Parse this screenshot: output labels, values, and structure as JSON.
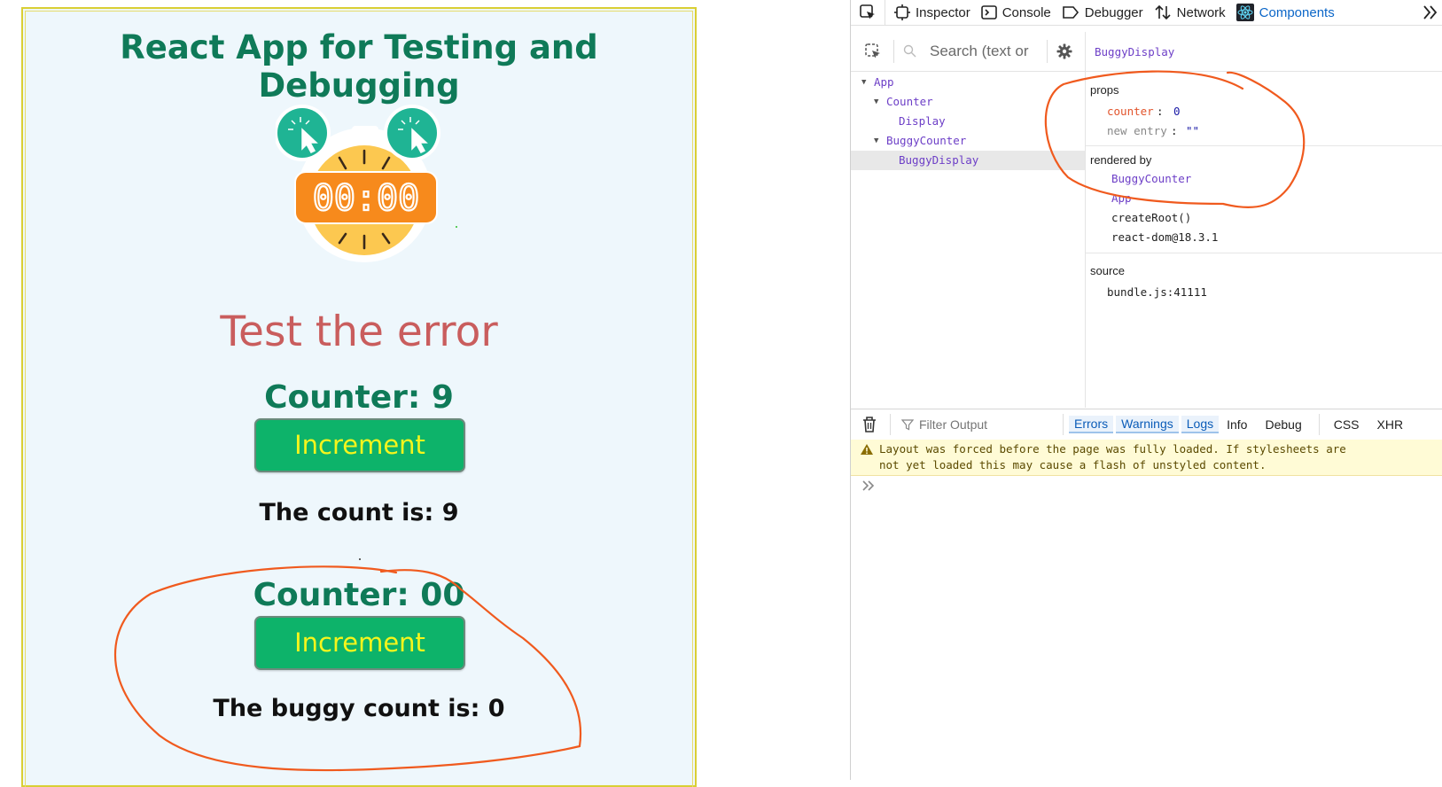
{
  "app": {
    "title": "React App for Testing and Debugging",
    "timer_display": "00:00",
    "section_heading": "Test the error",
    "counter_one": {
      "title": "Counter: 9",
      "button_label": "Increment",
      "count_text": "The count is: 9"
    },
    "counter_two": {
      "title": "Counter: 00",
      "button_label": "Increment",
      "count_text": "The buggy count is: 0"
    }
  },
  "devtools": {
    "tabs": [
      {
        "label": "Inspector",
        "icon": "inspector-icon"
      },
      {
        "label": "Console",
        "icon": "console-icon"
      },
      {
        "label": "Debugger",
        "icon": "debugger-icon"
      },
      {
        "label": "Network",
        "icon": "network-icon"
      },
      {
        "label": "Components",
        "icon": "react-icon",
        "active": true
      }
    ],
    "components": {
      "search_placeholder": "Search (text or",
      "selected_component": "BuggyDisplay",
      "tree": [
        {
          "label": "App",
          "depth": 0,
          "expanded": true
        },
        {
          "label": "Counter",
          "depth": 1,
          "expanded": true
        },
        {
          "label": "Display",
          "depth": 2
        },
        {
          "label": "BuggyCounter",
          "depth": 1,
          "expanded": true
        },
        {
          "label": "BuggyDisplay",
          "depth": 2,
          "selected": true
        }
      ],
      "props_label": "props",
      "props": [
        {
          "key": "counter",
          "value": "0"
        },
        {
          "key": "new entry",
          "value": "\"\""
        }
      ],
      "rendered_by_label": "rendered by",
      "rendered_by": [
        "BuggyCounter",
        "App",
        "createRoot()",
        "react-dom@18.3.1"
      ],
      "source_label": "source",
      "source": "bundle.js:41111"
    },
    "console": {
      "filter_placeholder": "Filter Output",
      "filters": [
        "Errors",
        "Warnings",
        "Logs",
        "Info",
        "Debug",
        "CSS",
        "XHR"
      ],
      "warning_line1": "Layout was forced before the page was fully loaded. If stylesheets are",
      "warning_line2": "not yet loaded this may cause a flash of unstyled content."
    }
  },
  "colors": {
    "title_green": "#0f7a58",
    "error_red": "#c95d5d",
    "button_green": "#0db36a",
    "button_text": "#f5f51c",
    "annotation": "#f05a1e",
    "react_purple": "#6d3fc7"
  }
}
